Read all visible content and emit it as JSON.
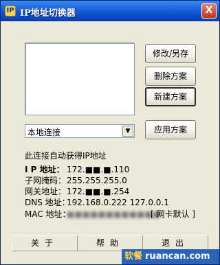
{
  "window": {
    "title": "IP地址切换器",
    "close_label": "X"
  },
  "buttons": {
    "modify_save": "修改/另存",
    "delete_scheme": "删除方案",
    "new_scheme": "新建方案",
    "apply_scheme": "应用方案"
  },
  "connection": {
    "selected": "本地连接",
    "status": "此连接自动获得IP地址"
  },
  "info": [
    {
      "label": "I P 地址：",
      "value": "172.■■.■.110"
    },
    {
      "label": "子网掩码：",
      "value": "255.255.255.0"
    },
    {
      "label": "网关地址：",
      "value": "172.■■.■.254"
    },
    {
      "label": "DNS 地址：",
      "value": "192.168.0.222  127.0.0.1"
    },
    {
      "label": "MAC 地址：",
      "value": "■■■■■■■■■■■■"
    }
  ],
  "nic_default": "[ 网卡默认 ]",
  "bottom": {
    "about": "关于",
    "help": "帮助",
    "exit": "退出"
  },
  "watermark": {
    "cn": "软餐",
    "url": "ruancan.com"
  }
}
